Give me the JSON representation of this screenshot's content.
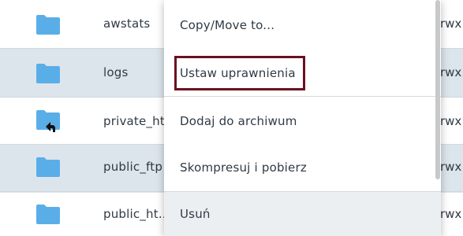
{
  "file_list": {
    "rows": [
      {
        "name": "awstats",
        "permissions": "rwx",
        "icon": "folder-icon"
      },
      {
        "name": "logs",
        "permissions": "rwx",
        "icon": "folder-icon"
      },
      {
        "name": "private_ht",
        "permissions": "rwx",
        "icon": "folder-symlink-icon"
      },
      {
        "name": "public_ftp",
        "permissions": "rwx",
        "icon": "folder-icon"
      },
      {
        "name": "public_ht",
        "permissions": "rwx",
        "icon": "folder-icon"
      }
    ],
    "truncation": "..."
  },
  "context_menu": {
    "items": [
      {
        "label": "Copy/Move to..."
      },
      {
        "label": "Ustaw uprawnienia",
        "highlighted": true
      },
      {
        "label": "Dodaj do archiwum"
      },
      {
        "label": "Skompresuj i pobierz"
      },
      {
        "label": "Usuń"
      }
    ]
  },
  "colors": {
    "folder": "#5aaee8",
    "row_alt": "#dde5ec",
    "highlight_border": "#6b0f1f",
    "text": "#2f3a45"
  }
}
